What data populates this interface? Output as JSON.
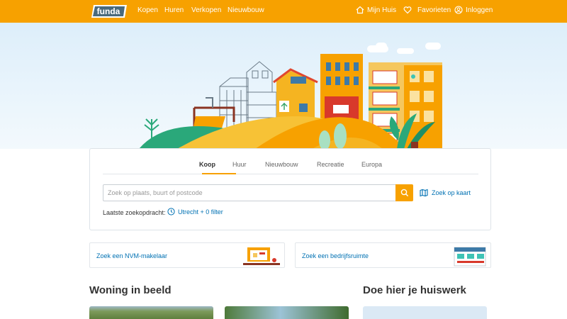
{
  "header": {
    "logo_text": "funda",
    "nav": [
      "Kopen",
      "Huren",
      "Verkopen",
      "Nieuwbouw"
    ],
    "mijn_huis": "Mijn Huis",
    "favorieten": "Favorieten",
    "inloggen": "Inloggen"
  },
  "search": {
    "tabs": [
      "Koop",
      "Huur",
      "Nieuwbouw",
      "Recreatie",
      "Europa"
    ],
    "active_tab": "Koop",
    "placeholder": "Zoek op plaats, buurt of postcode",
    "map_link": "Zoek op kaart",
    "last_search_label": "Laatste zoekopdracht:",
    "last_search_value": "Utrecht + 0 filter"
  },
  "promos": {
    "makelaar": "Zoek een NVM-makelaar",
    "bedrijfsruimte": "Zoek een bedrijfsruimte"
  },
  "sections": {
    "woning_in_beeld": "Woning in beeld",
    "huiswerk": "Doe hier je huiswerk"
  },
  "colors": {
    "brand_orange": "#f7a100",
    "link_blue": "#0071b3"
  }
}
